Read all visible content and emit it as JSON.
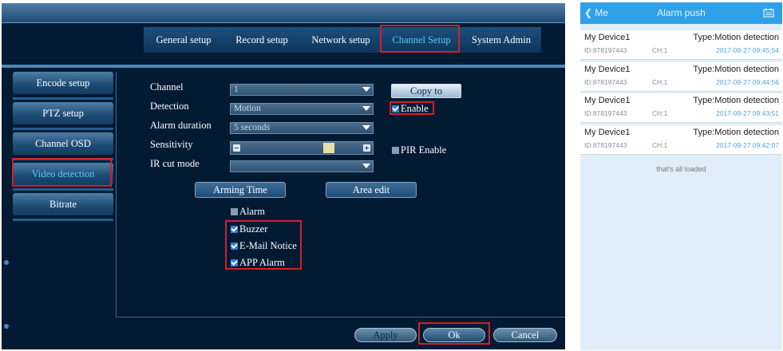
{
  "dvr": {
    "tabs": [
      "General setup",
      "Record setup",
      "Network setup",
      "Channel Setup",
      "System Admin"
    ],
    "active_tab": "Channel Setup",
    "sidebar": [
      "Encode setup",
      "PTZ setup",
      "Channel OSD",
      "Video detection",
      "Bitrate"
    ],
    "active_sidebar": "Video detection",
    "fields": {
      "channel_label": "Channel",
      "channel_value": "1",
      "detection_label": "Detection",
      "detection_value": "Motion",
      "alarm_duration_label": "Alarm duration",
      "alarm_duration_value": "5 seconds",
      "sensitivity_label": "Sensitivity",
      "sensitivity_level": 0.75,
      "ir_cut_label": "IR cut mode",
      "ir_cut_value": ""
    },
    "buttons": {
      "copy_to": "Copy to",
      "arming_time": "Arming Time",
      "area_edit": "Area edit",
      "apply": "Apply",
      "ok": "Ok",
      "cancel": "Cancel"
    },
    "checkboxes": {
      "enable": {
        "label": "Enable",
        "checked": true
      },
      "pir_enable": {
        "label": "PIR Enable",
        "checked": false
      },
      "alarm": {
        "label": "Alarm",
        "checked": false
      },
      "buzzer": {
        "label": "Buzzer",
        "checked": true
      },
      "email_notice": {
        "label": "E-Mail Notice",
        "checked": true
      },
      "app_alarm": {
        "label": "APP Alarm",
        "checked": true
      }
    },
    "colors": {
      "background": "#031a33",
      "active_text": "#5cc8ff",
      "highlight": "#d0202a"
    }
  },
  "phone": {
    "back_label": "Me",
    "title": "Alarm push",
    "icon": "calendar-icon",
    "records": [
      {
        "device": "My Device1",
        "id": "ID:878197443",
        "channel": "CH:1",
        "type": "Type:Motion detection",
        "time": "2017-09-27 09:45:54"
      },
      {
        "device": "My Device1",
        "id": "ID:878197443",
        "channel": "CH:1",
        "type": "Type:Motion detection",
        "time": "2017-09-27 09:44:56"
      },
      {
        "device": "My Device1",
        "id": "ID:878197443",
        "channel": "CH:1",
        "type": "Type:Motion detection",
        "time": "2017-09-27 09:43:51"
      },
      {
        "device": "My Device1",
        "id": "ID:878197443",
        "channel": "CH:1",
        "type": "Type:Motion detection",
        "time": "2017-09-27 09:42:07"
      }
    ],
    "footer": "that's all loaded",
    "colors": {
      "bar": "#2fa1e8",
      "time": "#4da3e0"
    }
  }
}
